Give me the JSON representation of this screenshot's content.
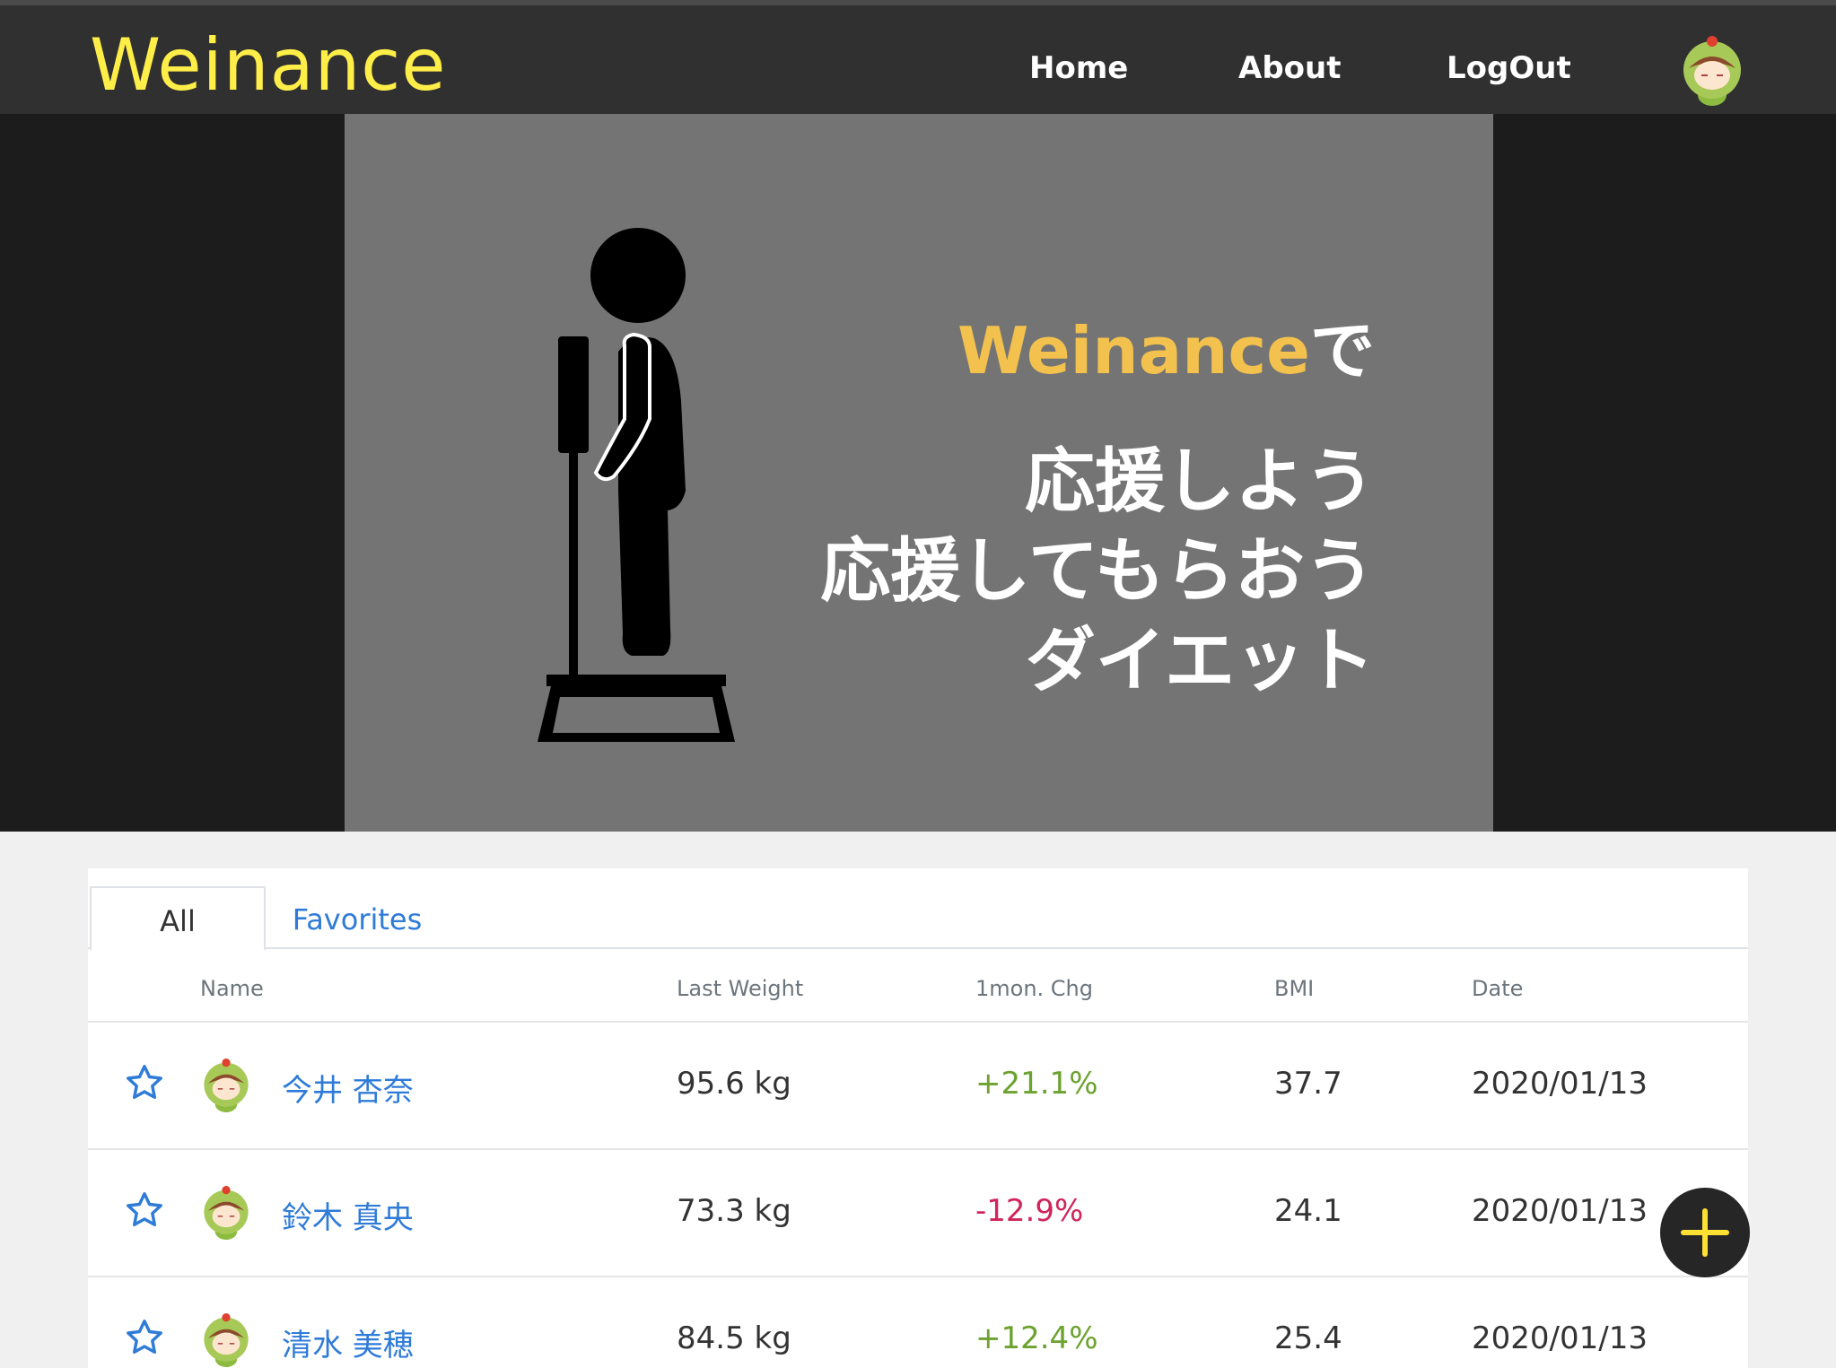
{
  "navbar": {
    "brand": "Weinance",
    "links": [
      {
        "label": "Home"
      },
      {
        "label": "About"
      },
      {
        "label": "LogOut"
      }
    ]
  },
  "hero": {
    "title_accent": "Weinance",
    "title_suffix": "で",
    "lines": [
      "応援しよう",
      "応援してもらおう",
      "ダイエット"
    ]
  },
  "tabs": [
    {
      "label": "All",
      "active": true
    },
    {
      "label": "Favorites",
      "active": false
    }
  ],
  "table": {
    "columns": [
      "Name",
      "Last Weight",
      "1mon. Chg",
      "BMI",
      "Date"
    ],
    "rows": [
      {
        "name": "今井 杏奈",
        "weight": "95.6 kg",
        "change": "+21.1%",
        "bmi": "37.7",
        "date": "2020/01/13"
      },
      {
        "name": "鈴木 真央",
        "weight": "73.3 kg",
        "change": "-12.9%",
        "bmi": "24.1",
        "date": "2020/01/13"
      },
      {
        "name": "清水 美穂",
        "weight": "84.5 kg",
        "change": "+12.4%",
        "bmi": "25.4",
        "date": "2020/01/13"
      }
    ]
  },
  "colors": {
    "brand": "#ffee48",
    "accent": "#f2c14e",
    "link": "#2f7bd8",
    "positive": "#6ca22e",
    "negative": "#d1245a",
    "fab_plus": "#ffe033"
  },
  "icons": {
    "favorite": "star-outline-icon",
    "avatar": "kappa-avatar-icon",
    "fab": "plus-icon"
  }
}
